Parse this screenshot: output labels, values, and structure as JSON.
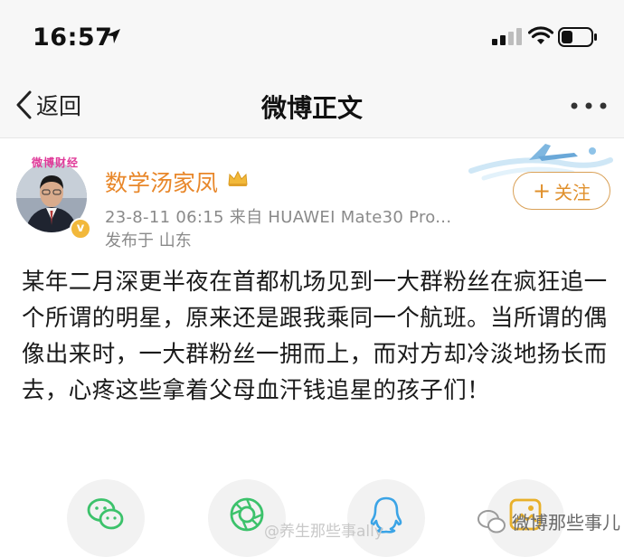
{
  "status_bar": {
    "time": "16:57",
    "location_icon": "location-arrow-icon",
    "signal_icon": "cellular-signal-icon",
    "wifi_icon": "wifi-icon",
    "battery_icon": "battery-icon",
    "battery_level": 0.35
  },
  "nav": {
    "back_label": "返回",
    "title": "微博正文",
    "more_icon": "more-dots-icon"
  },
  "author": {
    "avatar_badge": "微博财经",
    "name": "数学汤家凤",
    "crown_icon": "crown-icon",
    "verified_icon": "verified-badge-icon",
    "meta": "23-8-11 06:15  来自 HUAWEI Mate30 Pro...",
    "location": "发布于 山东",
    "follow_label": "关注"
  },
  "post": {
    "text": "某年二月深更半夜在首都机场见到一大群粉丝在疯狂追一个所谓的明星，原来还是跟我乘同一个航班。当所谓的偶像出来时，一大群粉丝一拥而上，而对方却冷淡地扬长而去，心疼这些拿着父母血汗钱追星的孩子们！"
  },
  "share": {
    "icons": [
      "wechat-icon",
      "moments-icon",
      "qq-icon",
      "qzone-icon"
    ]
  },
  "watermarks": {
    "weibo_handle": "@养生那些事ally",
    "wechat_account": "微博那些事儿"
  },
  "colors": {
    "accent_orange": "#e8872a",
    "share_green": "#3cc26b",
    "share_blue": "#3ba4e6",
    "share_yellow": "#e8b02a"
  }
}
